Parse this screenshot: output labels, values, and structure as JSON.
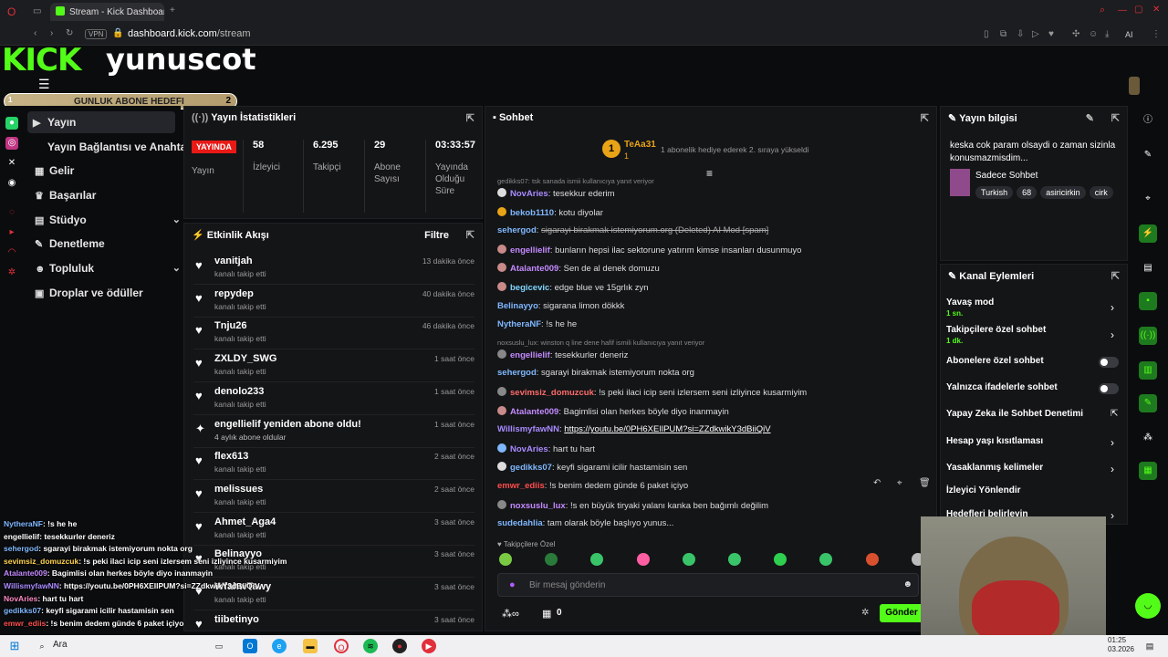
{
  "browser": {
    "tab_title": "Stream - Kick Dashboard",
    "url_host": "dashboard.kick.com",
    "url_path": "/stream",
    "vpn_label": "VPN",
    "ai_label": "AI"
  },
  "header": {
    "logo": "KICK",
    "channel_name": "yunuscot",
    "goal": {
      "left_value": "1",
      "label": "GUNLUK ABONE HEDEFI",
      "right_value": "2",
      "progress": 0.5
    }
  },
  "sidebar": {
    "items": [
      {
        "label": "Yayın",
        "icon": "play-icon"
      },
      {
        "label": "Yayın Bağlantısı ve Anahtarı",
        "icon": ""
      },
      {
        "label": "Gelir",
        "icon": "chart-icon"
      },
      {
        "label": "Başarılar",
        "icon": "trophy-icon"
      },
      {
        "label": "Stüdyo",
        "icon": "studio-icon"
      },
      {
        "label": "Denetleme",
        "icon": "wrench-icon"
      },
      {
        "label": "Topluluk",
        "icon": "people-icon"
      },
      {
        "label": "Droplar ve ödüller",
        "icon": "gift-icon"
      }
    ]
  },
  "stats": {
    "title": "Yayın İstatistikleri",
    "live_badge": "YAYINDA",
    "live_label": "Yayın",
    "items": [
      {
        "value": "58",
        "label": "İzleyici"
      },
      {
        "value": "6.295",
        "label": "Takipçi"
      },
      {
        "value": "29",
        "label": "Abone Sayısı"
      },
      {
        "value": "03:33:57",
        "label": "Yayında Olduğu Süre"
      }
    ]
  },
  "activity": {
    "title": "Etkinlik Akışı",
    "filter": "Filtre",
    "rows": [
      {
        "name": "vanitjah",
        "sub": "kanalı takip etti",
        "time": "13 dakika önce"
      },
      {
        "name": "repydep",
        "sub": "kanalı takip etti",
        "time": "40 dakika önce"
      },
      {
        "name": "Tnju26",
        "sub": "kanalı takip etti",
        "time": "46 dakika önce"
      },
      {
        "name": "ZXLDY_SWG",
        "sub": "kanalı takip etti",
        "time": "1 saat önce"
      },
      {
        "name": "denolo233",
        "sub": "kanalı takip etti",
        "time": "1 saat önce"
      },
      {
        "name": "engellielif yeniden abone oldu!",
        "sub": "4 aylık abone oldular",
        "time": "1 saat önce"
      },
      {
        "name": "flex613",
        "sub": "kanalı takip etti",
        "time": "2 saat önce"
      },
      {
        "name": "melissues",
        "sub": "kanalı takip etti",
        "time": "2 saat önce"
      },
      {
        "name": "Ahmet_Aga4",
        "sub": "kanalı takip etti",
        "time": "3 saat önce"
      },
      {
        "name": "Belinayyo",
        "sub": "kanalı takip etti",
        "time": "3 saat önce"
      },
      {
        "name": "WfahwTawy",
        "sub": "kanalı takip etti",
        "time": "3 saat önce"
      },
      {
        "name": "tiibetinyo",
        "sub": "",
        "time": "3 saat önce"
      }
    ]
  },
  "chat": {
    "title": "Sohbet",
    "pinned_user": "TeAa31",
    "pinned_count": "1",
    "pinned_text": "1 abonelik hediye ederek 2. sıraya yükseldi",
    "messages": [
      {
        "reply": "gedikks07: tsk sanada ismii kullanıcıya yanıt veriyor"
      },
      {
        "user": "NovAries",
        "color": "#a98aff",
        "text": "tesekkur ederim"
      },
      {
        "user": "bekob1110",
        "color": "#7fb8ff",
        "text": "kotu diyolar"
      },
      {
        "user": "sehergod",
        "color": "#7fb8ff",
        "text": "sigarayi birakmak istemiyorum.org (Deleted) AI Mod [spam]"
      },
      {
        "user": "engellielif",
        "color": "#c38aff",
        "text": "bunların hepsi ilac sektorune yatırım kimse insanları dusunmuyo"
      },
      {
        "user": "Atalante009",
        "color": "#c38aff",
        "text": "Sen de al denek domuzu"
      },
      {
        "user": "begicevic",
        "color": "#7fd6ff",
        "text": "edge blue ve 15grlık zyn"
      },
      {
        "user": "Belinayyo",
        "color": "#7fb8ff",
        "text": "sigarana limon dökkk"
      },
      {
        "user": "NytheraNF",
        "color": "#7fb8ff",
        "text": "!s he he"
      },
      {
        "reply": "noxsuslu_lux: winston q line dene hafif ismili kullanıcıya yanıt veriyor"
      },
      {
        "user": "engellielif",
        "color": "#c38aff",
        "text": "tesekkurler deneriz"
      },
      {
        "user": "sehergod",
        "color": "#7fb8ff",
        "text": "sgarayi birakmak istemiyorum nokta org"
      },
      {
        "user": "sevimsiz_domuzcuk",
        "color": "#ff6b6b",
        "text": "!s peki ilaci icip seni izlersem seni izliyince kusarmiyim"
      },
      {
        "user": "Atalante009",
        "color": "#c38aff",
        "text": "Bagimlisi olan herkes böyle diyo inanmayin"
      },
      {
        "user": "WillismyfawNN",
        "color": "#a98aff",
        "text": "https://youtu.be/0PH6XEIlPUM?si=ZZdkwikY3dBiiQiV"
      },
      {
        "user": "NovAries",
        "color": "#a98aff",
        "text": "hart tu hart"
      },
      {
        "user": "gedikks07",
        "color": "#7fb8ff",
        "text": "keyfi sigarami icilir hastamisin sen"
      },
      {
        "user": "emwr_ediis",
        "color": "#ff4d4d",
        "text": "!s benim dedem günde 6 paket içiyo"
      },
      {
        "user": "noxsuslu_lux",
        "color": "#c38aff",
        "text": "!s en büyük tiryaki yalanı kanka ben bağımlı değilim"
      },
      {
        "user": "sudedahlia",
        "color": "#7fb8ff",
        "text": "tam olarak böyle başlıyo yunus..."
      }
    ],
    "followers_only": "Takipçilere Özel",
    "input_placeholder": "Bir mesaj gönderin",
    "points": "0",
    "send": "Gönder"
  },
  "stream_info": {
    "title": "Yayın bilgisi",
    "stream_title": "keska cok param olsaydi o zaman sizinla konusmazmisdim...",
    "category": "Sadece Sohbet",
    "tags": [
      "Turkish",
      "68",
      "asiricirkin",
      "cirk"
    ]
  },
  "channel_actions": {
    "title": "Kanal Eylemleri",
    "items": [
      {
        "label": "Yavaş mod",
        "sub": "1 sn.",
        "control": "chevron"
      },
      {
        "label": "Takipçilere özel sohbet",
        "sub": "1 dk.",
        "control": "chevron"
      },
      {
        "label": "Abonelere özel sohbet",
        "sub": "",
        "control": "toggle"
      },
      {
        "label": "Yalnızca ifadelerle sohbet",
        "sub": "",
        "control": "toggle"
      },
      {
        "label": "Yapay Zeka ile Sohbet Denetimi",
        "sub": "",
        "control": "external"
      },
      {
        "label": "Hesap yaşı kısıtlaması",
        "sub": "",
        "control": "chevron"
      },
      {
        "label": "Yasaklanmış kelimeler",
        "sub": "",
        "control": "chevron"
      },
      {
        "label": "İzleyici Yönlendir",
        "sub": "",
        "control": ""
      },
      {
        "label": "Hedefleri belirleyin",
        "sub": "",
        "control": "chevron"
      }
    ]
  },
  "overlay_chat": [
    {
      "user": "NytheraNF",
      "color": "#7fb8ff",
      "text": ": !s he he"
    },
    {
      "user": "engellielif",
      "color": "#ffffff",
      "text": ": tesekkurler deneriz"
    },
    {
      "user": "sehergod",
      "color": "#7fb8ff",
      "text": ": sgarayi birakmak istemiyorum nokta org"
    },
    {
      "user": "sevimsiz_domuzcuk",
      "color": "#ffd34d",
      "text": ": !s peki ilaci icip seni izlersem seni izliyince kusarmiyim"
    },
    {
      "user": "Atalante009",
      "color": "#c38aff",
      "text": ": Bagimlisi olan herkes böyle diyo inanmayin"
    },
    {
      "user": "WillismyfawNN",
      "color": "#a98aff",
      "text": ": https://youtu.be/0PH6XEIlPUM?si=ZZdkwikY3dBiiQiV"
    },
    {
      "user": "NovAries",
      "color": "#ff8ac3",
      "text": ": hart tu hart"
    },
    {
      "user": "gedikks07",
      "color": "#7fb8ff",
      "text": ": keyfi sigarami icilir hastamisin sen"
    },
    {
      "user": "emwr_ediis",
      "color": "#ff4d4d",
      "text": ": !s benim dedem günde 6 paket içiyo"
    }
  ],
  "taskbar": {
    "search": "Ara",
    "time": "01:25",
    "date": "03.2026"
  },
  "colors": {
    "accent": "#53fc18",
    "live": "#e91916"
  }
}
